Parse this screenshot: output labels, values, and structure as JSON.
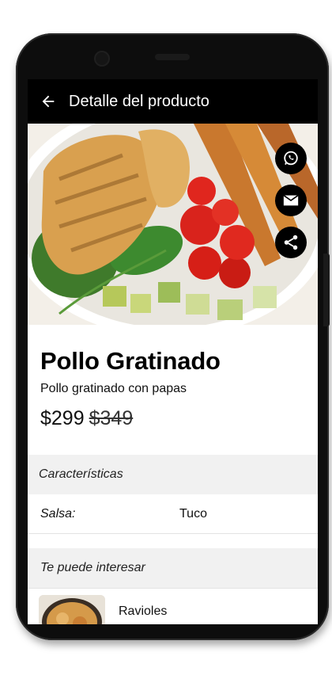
{
  "appbar": {
    "title": "Detalle del producto"
  },
  "share_actions": [
    {
      "name": "whatsapp",
      "icon": "whatsapp-icon"
    },
    {
      "name": "email",
      "icon": "mail-icon"
    },
    {
      "name": "share",
      "icon": "share-icon"
    }
  ],
  "product": {
    "name": "Pollo Gratinado",
    "description": "Pollo gratinado con papas",
    "price": "$299",
    "old_price": "$349"
  },
  "features": {
    "header": "Características",
    "rows": [
      {
        "label": "Salsa:",
        "value": "Tuco"
      }
    ]
  },
  "related": {
    "header": "Te puede interesar",
    "items": [
      {
        "name": "Ravioles"
      }
    ]
  },
  "colors": {
    "appbar": "#000000",
    "section_bg": "#f1f1f1"
  }
}
